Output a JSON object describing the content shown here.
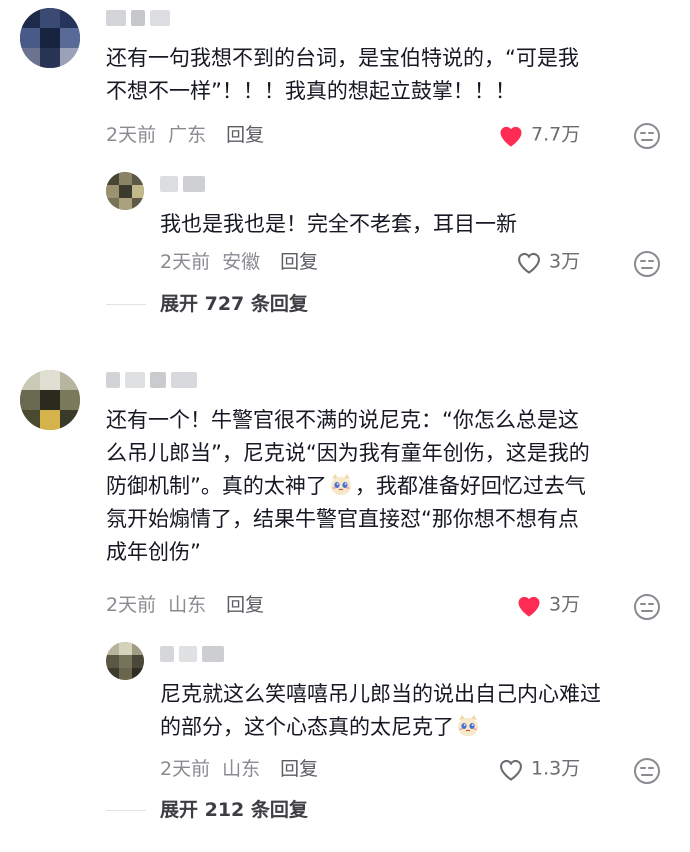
{
  "comments": [
    {
      "text_lines": [
        "还有一句我想不到的台词，是宝伯特说的，“可是我",
        "不想不一样”！！！我真的想起立鼓掌！！！"
      ],
      "time": "2天前",
      "location": "广东",
      "reply_label": "回复",
      "likes": "7.7万",
      "liked": true,
      "replies": [
        {
          "text_lines": [
            "我也是我也是！完全不老套，耳目一新"
          ],
          "time": "2天前",
          "location": "安徽",
          "reply_label": "回复",
          "likes": "3万",
          "liked": false
        }
      ],
      "expand_label": "展开 727 条回复"
    },
    {
      "text_lines": [
        "还有一个！牛警官很不满的说尼克：“你怎么总是这",
        "么吊儿郎当”，尼克说“因为我有童年创伤，这是我的",
        "防御机制”。真的太神了",
        "，我都准备好回忆过去气",
        "氛开始煽情了，结果牛警官直接怼“那你想不想有点",
        "成年创伤”"
      ],
      "time": "2天前",
      "location": "山东",
      "reply_label": "回复",
      "likes": "3万",
      "liked": true,
      "replies": [
        {
          "text_lines": [
            "尼克就这么笑嘻嘻吊儿郎当的说出自己内心难过",
            "的部分，这个心态真的太尼克了"
          ],
          "time": "2天前",
          "location": "山东",
          "reply_label": "回复",
          "likes": "1.3万",
          "liked": false
        }
      ],
      "expand_label": "展开 212 条回复"
    }
  ],
  "colors": {
    "liked_heart": "#fe2c55",
    "meta_text": "#8a8b91",
    "body_text": "#161823"
  },
  "icons": [
    "heart-filled-icon",
    "heart-outline-icon",
    "dislike-face-icon",
    "crying-cat-emoji"
  ]
}
